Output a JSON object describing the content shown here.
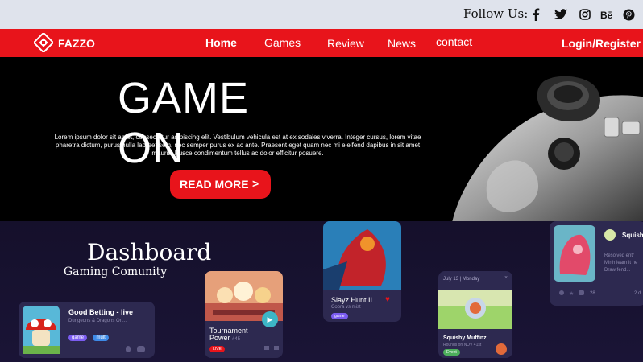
{
  "followbar": {
    "label": "Follow Us:",
    "icons": [
      "facebook-icon",
      "twitter-icon",
      "instagram-icon",
      "behance-icon",
      "pinterest-icon"
    ]
  },
  "nav": {
    "brand": "FAZZO",
    "links": [
      "Home",
      "Games",
      "Review",
      "News",
      "contact"
    ],
    "login": "Login/Register",
    "accent": "#e8141b"
  },
  "hero": {
    "title": "GAME ON",
    "body": "Lorem ipsum dolor sit amet, consectetur adipiscing elit. Vestibulum vehicula est at ex sodales viverra. Integer cursus, lorem vitae pharetra dictum, purus nulla laoreet sem, nec semper purus ex ac ante. Praesent eget quam nec mi eleifend dapibus in sit amet mauris. Fusce condimentum tellus ac dolor efficitur posuere.",
    "cta": "READ MORE",
    "cta_arrow": ">"
  },
  "dashboard": {
    "title": "Dashboard",
    "subtitle": "Gaming Comunity",
    "cards": {
      "betting": {
        "title": "Good Betting - live",
        "sub": "Dungeons & Dragons On...",
        "tags": [
          "game",
          "mult"
        ]
      },
      "tournament": {
        "title": "Tournament Power",
        "number": "#45",
        "badge": "LIVE"
      },
      "slayz": {
        "title": "Slayz Hunt II",
        "sub": "Cobra vs mist",
        "tag": "game"
      },
      "squishy": {
        "date": "July 13",
        "day": "Monday",
        "title": "Squishy Muffinz",
        "sub": "Rounds on NOV 41st",
        "tag": "Event"
      },
      "squish": {
        "title": "Squish",
        "lines": [
          "Resolved entr",
          "Mirth learn it he",
          "Draw fend..."
        ],
        "count": "28",
        "extra": "2 d"
      }
    }
  }
}
